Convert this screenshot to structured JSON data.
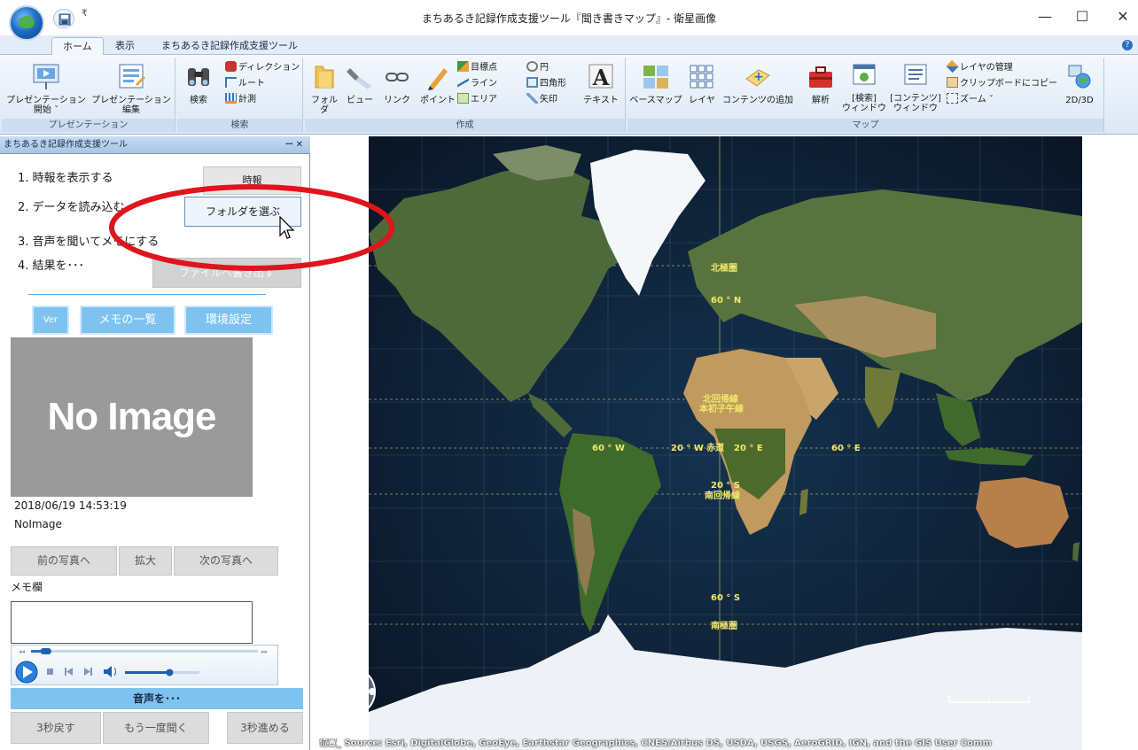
{
  "window": {
    "title": "まちあるき記録作成支援ツール『聞き書きマップ』- 衛星画像",
    "minimize": "—",
    "maximize": "☐",
    "close": "✕",
    "qat_dropdown": "₹"
  },
  "ribbon": {
    "tabs": [
      "ホーム",
      "表示",
      "まちあるき記録作成支援ツール"
    ],
    "groups": {
      "presentation": {
        "label": "プレゼンテーション",
        "start_line1": "プレゼンテーション",
        "start_line2": "開始 ˇ",
        "edit_line1": "プレゼンテーション",
        "edit_line2": "編集"
      },
      "search": {
        "label": "検索",
        "search": "検索",
        "direction": "ディレクション",
        "route": "ルート",
        "measure": "計測"
      },
      "create": {
        "label": "作成",
        "folder": "フォルダ",
        "view": "ビュー",
        "link": "リンク",
        "point": "ポイント",
        "target_point": "目標点",
        "line": "ライン",
        "area": "エリア",
        "circle": "円",
        "rectangle": "四角形",
        "arrow": "矢印",
        "text": "テキスト"
      },
      "map": {
        "label": "マップ",
        "basemap": "ベースマップ",
        "layer": "レイヤ",
        "add_content": "コンテンツの追加",
        "analysis": "解析",
        "search_window_line1": "[検索]",
        "search_window_line2": "ウィンドウ",
        "content_window_line1": "[コンテンツ]",
        "content_window_line2": "ウィンドウ",
        "layer_manage": "レイヤの管理",
        "clipboard_copy": "クリップボードにコピー",
        "zoom": "ズーム ˇ",
        "two_three_d": "2D/3D"
      }
    },
    "help": "?"
  },
  "panel": {
    "title": "まちあるき記録作成支援ツール",
    "header_buttons": "ꟷ ✕",
    "steps": [
      "1. 時報を表示する",
      "2. データを読み込む",
      "3. 音声を聞いてメモにする",
      "4. 結果を･･･"
    ],
    "time_signal_button": "時報",
    "choose_folder_button": "フォルダを選ぶ",
    "export_file_button": "ファイルへ書き出す",
    "ver_button": "Ver",
    "memo_list_button": "メモの一覧",
    "settings_button": "環境設定",
    "no_image_text": "No Image",
    "timestamp": "2018/06/19 14:53:19",
    "image_name": "NoImage",
    "prev_photo": "前の写真へ",
    "enlarge": "拡大",
    "next_photo": "次の写真へ",
    "memo_label": "メモ欄",
    "player_progress": 0.05,
    "player_volume": 0.6,
    "voice_label": "音声を･･･",
    "back_3s": "3秒戻す",
    "listen_again": "もう一度聞く",
    "forward_3s": "3秒進める"
  },
  "map": {
    "labels": {
      "arctic": "北極圏",
      "lat60n": "60 ° N",
      "tropic_cancer": "北回帰線",
      "prime_meridian": "本初子午線",
      "lon60w": "60 ° W",
      "lon20w": "20 ° W",
      "equator": "赤道",
      "lon20e": "20 ° E",
      "lon60e": "60 ° E",
      "lat20s": "20 ° S",
      "tropic_capricorn": "南回帰線",
      "lat60s": "60 ° S",
      "antarctic": "南極圏"
    },
    "esri": "esri",
    "attribution": "位置_ Source: Esri, DigitalGlobe, GeoEye, Earthstar Geographics, CNES/Airbus DS, USDA, USGS, AeroGRID, IGN, and the GIS User Comm",
    "label_color": "#f3e86a"
  },
  "colors": {
    "highlight_ellipse": "#e0141b",
    "accent_blue": "#7ec3ef"
  }
}
